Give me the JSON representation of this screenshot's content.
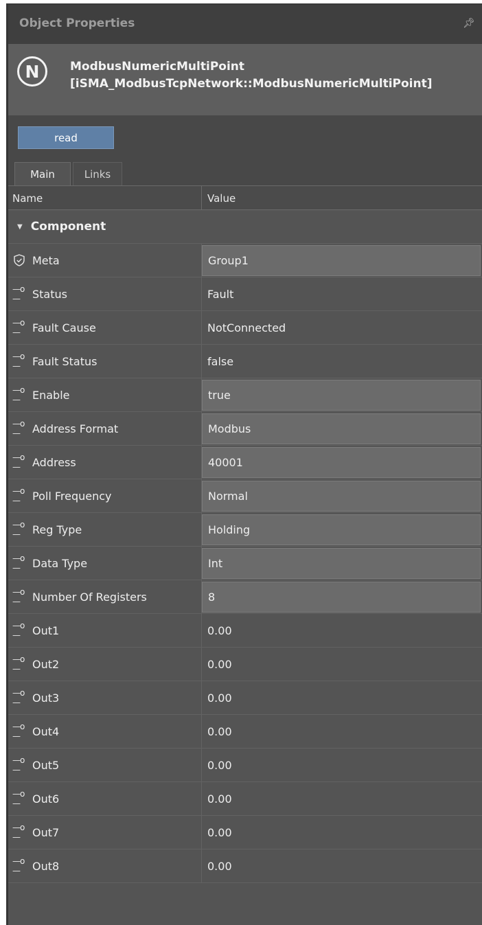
{
  "panel": {
    "title": "Object Properties",
    "pin_icon": "pin-icon"
  },
  "object": {
    "icon_letter": "N",
    "name": "ModbusNumericMultiPoint",
    "type": "[iSMA_ModbusTcpNetwork::ModbusNumericMultiPoint]"
  },
  "actions": {
    "read_label": "read"
  },
  "tabs": [
    {
      "label": "Main",
      "active": true
    },
    {
      "label": "Links",
      "active": false
    }
  ],
  "grid": {
    "header": {
      "name": "Name",
      "value": "Value"
    },
    "section": "Component",
    "rows": [
      {
        "icon": "shield-icon",
        "name": "Meta",
        "value": "Group1",
        "editable": true
      },
      {
        "icon": "slot-icon",
        "name": "Status",
        "value": "Fault",
        "editable": false
      },
      {
        "icon": "slot-icon",
        "name": "Fault Cause",
        "value": "NotConnected",
        "editable": false
      },
      {
        "icon": "slot-icon",
        "name": "Fault Status",
        "value": "false",
        "editable": false
      },
      {
        "icon": "slot-icon",
        "name": "Enable",
        "value": "true",
        "editable": true
      },
      {
        "icon": "slot-icon",
        "name": "Address Format",
        "value": "Modbus",
        "editable": true
      },
      {
        "icon": "slot-icon",
        "name": "Address",
        "value": "40001",
        "editable": true
      },
      {
        "icon": "slot-icon",
        "name": "Poll Frequency",
        "value": "Normal",
        "editable": true
      },
      {
        "icon": "slot-icon",
        "name": "Reg Type",
        "value": "Holding",
        "editable": true
      },
      {
        "icon": "slot-icon",
        "name": "Data Type",
        "value": "Int",
        "editable": true
      },
      {
        "icon": "slot-icon",
        "name": "Number Of Registers",
        "value": "8",
        "editable": true
      },
      {
        "icon": "slot-icon",
        "name": "Out1",
        "value": "0.00",
        "editable": false
      },
      {
        "icon": "slot-icon",
        "name": "Out2",
        "value": "0.00",
        "editable": false
      },
      {
        "icon": "slot-icon",
        "name": "Out3",
        "value": "0.00",
        "editable": false
      },
      {
        "icon": "slot-icon",
        "name": "Out4",
        "value": "0.00",
        "editable": false
      },
      {
        "icon": "slot-icon",
        "name": "Out5",
        "value": "0.00",
        "editable": false
      },
      {
        "icon": "slot-icon",
        "name": "Out6",
        "value": "0.00",
        "editable": false
      },
      {
        "icon": "slot-icon",
        "name": "Out7",
        "value": "0.00",
        "editable": false
      },
      {
        "icon": "slot-icon",
        "name": "Out8",
        "value": "0.00",
        "editable": false
      }
    ]
  }
}
